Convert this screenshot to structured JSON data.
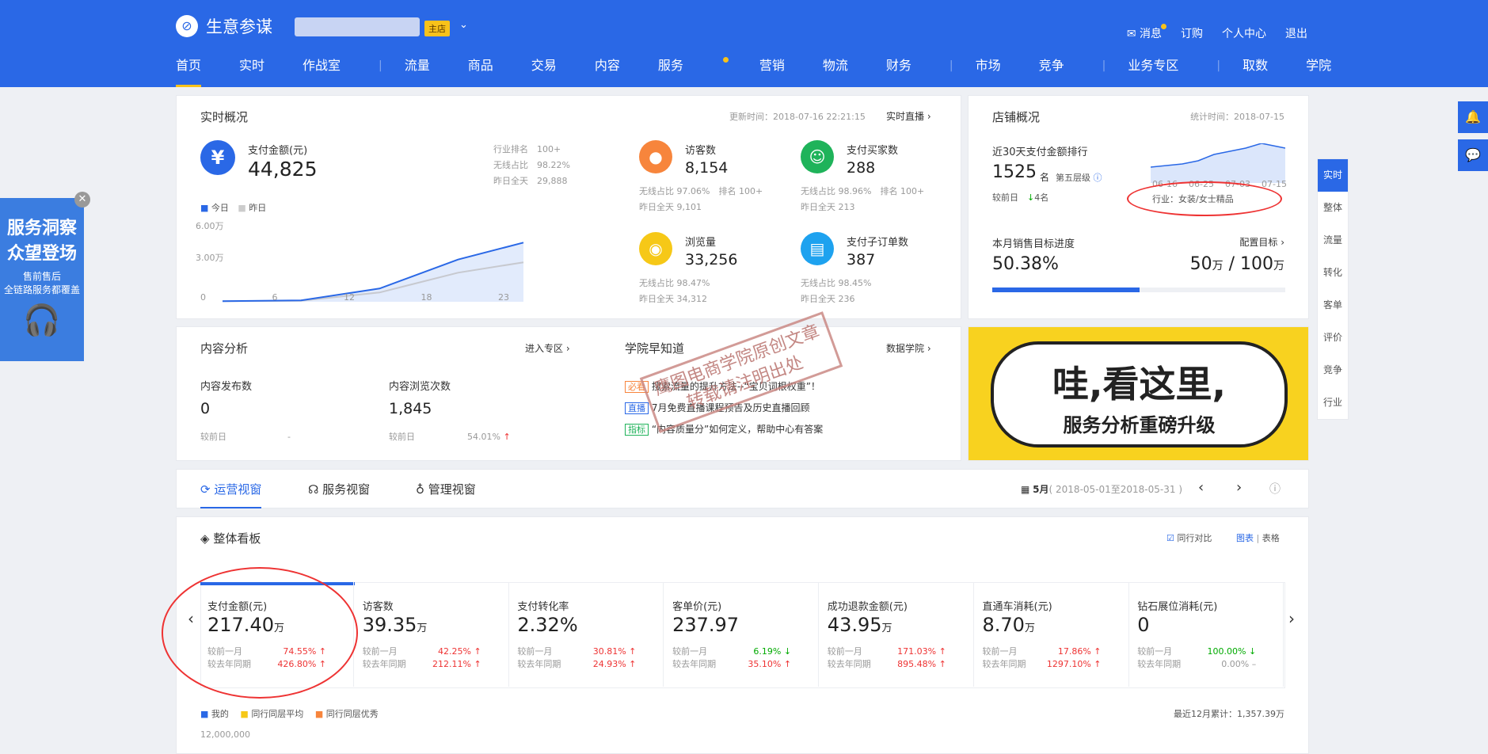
{
  "app": {
    "title": "生意参谋",
    "tag": "主店"
  },
  "top_links": [
    "消息",
    "订购",
    "个人中心",
    "退出"
  ],
  "nav": [
    "首页",
    "实时",
    "作战室",
    "流量",
    "商品",
    "交易",
    "内容",
    "服务",
    "营销",
    "物流",
    "财务",
    "市场",
    "竞争",
    "业务专区",
    "取数",
    "学院"
  ],
  "realtime": {
    "title": "实时概况",
    "update": "更新时间：2018-07-16 22:21:15",
    "live": "实时直播",
    "pay": {
      "label": "支付金额(元)",
      "value": "44,825",
      "rank_l": "行业排名",
      "rank_v": "100+",
      "wx_l": "无线占比",
      "wx_v": "98.22%",
      "yd_l": "昨日全天",
      "yd_v": "29,888"
    },
    "legend": [
      "今日",
      "昨日"
    ],
    "yticks": [
      "6.00万",
      "3.00万"
    ],
    "xticks": [
      "0",
      "6",
      "12",
      "18",
      "23"
    ],
    "visitors": {
      "label": "访客数",
      "value": "8,154",
      "wx": "97.06%",
      "rank": "100+",
      "yd": "9,101"
    },
    "buyers": {
      "label": "支付买家数",
      "value": "288",
      "wx": "98.96%",
      "rank": "100+",
      "yd": "213"
    },
    "pv": {
      "label": "浏览量",
      "value": "33,256",
      "wx": "98.47%",
      "yd": "34,312"
    },
    "orders": {
      "label": "支付子订单数",
      "value": "387",
      "wx": "98.45%",
      "yd": "236"
    },
    "l_wx": "无线占比",
    "l_rank": "排名",
    "l_yd": "昨日全天"
  },
  "shop": {
    "title": "店铺概况",
    "stat": "统计时间：2018-07-15",
    "rank_title": "近30天支付金额排行",
    "rank": "1525",
    "rank_unit": "名",
    "level": "第五层级",
    "cmp": "较前日",
    "cmp_v": "4名",
    "dates": [
      "06-16",
      "06-25",
      "07-03",
      "07-15"
    ],
    "industry": "行业：女装/女士精品",
    "target_title": "本月销售目标进度",
    "config": "配置目标",
    "pct": "50.38%",
    "progress": 0.5038,
    "amount": "50",
    "total": "100",
    "unit": "万",
    "slash": "/"
  },
  "content": {
    "title": "内容分析",
    "enter": "进入专区",
    "pub_l": "内容发布数",
    "pub_v": "0",
    "view_l": "内容浏览次数",
    "view_v": "1,845",
    "cmp": "较前日",
    "dash": "-",
    "view_cmp": "54.01%"
  },
  "academy": {
    "title": "学院早知道",
    "more": "数据学院",
    "items": [
      {
        "tag": "必看",
        "text": "搜索流量的提升方法--“宝贝词根权重”！"
      },
      {
        "tag": "直播",
        "text": "7月免费直播课程预告及历史直播回顾"
      },
      {
        "tag": "指标",
        "text": "“内容质量分”如何定义，帮助中心有答案"
      }
    ]
  },
  "watermark": [
    "鹰图电商学院原创文章",
    "转载请注明出处"
  ],
  "banner": {
    "line1": "哇,看这里,",
    "line2": "服务分析重磅升级"
  },
  "tabs": [
    "运营视窗",
    "服务视窗",
    "管理视窗"
  ],
  "period": {
    "month": "5月",
    "range": "( 2018-05-01至2018-05-31 )"
  },
  "board": {
    "title": "整体看板",
    "compare": "同行对比",
    "chart": "图表",
    "table": "表格",
    "divider": "|"
  },
  "kpis": [
    {
      "label": "支付金额(元)",
      "value": "217.40",
      "unit": "万",
      "m": "74.55%",
      "y": "426.80%",
      "mdir": "up",
      "ydir": "up"
    },
    {
      "label": "访客数",
      "value": "39.35",
      "unit": "万",
      "m": "42.25%",
      "y": "212.11%",
      "mdir": "up",
      "ydir": "up"
    },
    {
      "label": "支付转化率",
      "value": "2.32%",
      "unit": "",
      "m": "30.81%",
      "y": "24.93%",
      "mdir": "up",
      "ydir": "up"
    },
    {
      "label": "客单价(元)",
      "value": "237.97",
      "unit": "",
      "m": "6.19%",
      "y": "35.10%",
      "mdir": "down",
      "ydir": "up"
    },
    {
      "label": "成功退款金额(元)",
      "value": "43.95",
      "unit": "万",
      "m": "171.03%",
      "y": "895.48%",
      "mdir": "up",
      "ydir": "up"
    },
    {
      "label": "直通车消耗(元)",
      "value": "8.70",
      "unit": "万",
      "m": "17.86%",
      "y": "1297.10%",
      "mdir": "up",
      "ydir": "up"
    },
    {
      "label": "钻石展位消耗(元)",
      "value": "0",
      "unit": "",
      "m": "100.00%",
      "y": "0.00%",
      "mdir": "down",
      "ydir": "none"
    }
  ],
  "kpi_l1": "较前一月",
  "kpi_l2": "较去年同期",
  "bottom": {
    "legend": [
      "我的",
      "同行同层平均",
      "同行同层优秀"
    ],
    "total": "最近12月累计：1,357.39万",
    "ytick": "12,000,000"
  },
  "side": [
    "实时",
    "整体",
    "流量",
    "转化",
    "客单",
    "评价",
    "竞争",
    "行业"
  ],
  "ad": {
    "t1": "服务洞察",
    "t2": "众望登场",
    "t3": "售前售后",
    "t4": "全链路服务都覆盖"
  },
  "chart_data": {
    "type": "area",
    "x": [
      0,
      6,
      12,
      18,
      23
    ],
    "series": [
      {
        "name": "今日",
        "values": [
          500,
          1000,
          10000,
          32000,
          44825
        ]
      },
      {
        "name": "昨日",
        "values": [
          400,
          800,
          7000,
          22000,
          29888
        ]
      }
    ],
    "ylim": [
      0,
      60000
    ],
    "xlabel": "",
    "ylabel": ""
  }
}
